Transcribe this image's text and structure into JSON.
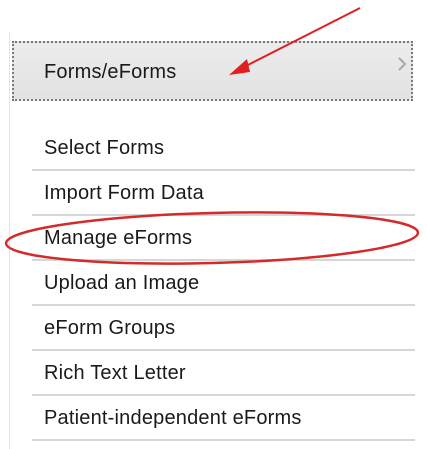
{
  "menu": {
    "header_label": "Forms/eForms",
    "items": [
      {
        "label": "Select Forms"
      },
      {
        "label": "Import Form Data"
      },
      {
        "label": "Manage eForms"
      },
      {
        "label": "Upload an Image"
      },
      {
        "label": "eForm Groups"
      },
      {
        "label": "Rich Text Letter"
      },
      {
        "label": "Patient-independent eForms"
      }
    ]
  },
  "annotations": {
    "arrow_color": "#e02020",
    "ellipse_color": "#d42a2a",
    "highlighted_item": "Manage eForms"
  },
  "icons": {
    "expand": "chevron-right-icon"
  }
}
